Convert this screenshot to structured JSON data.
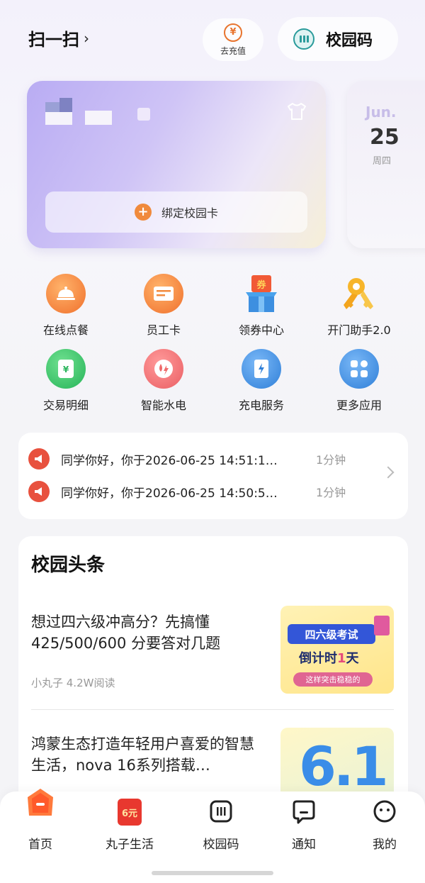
{
  "header": {
    "scan_label": "扫一扫",
    "scan_chevron": "›",
    "recharge_icon": "¥",
    "recharge_label": "去充值",
    "campus_code_label": "校园码"
  },
  "card": {
    "bind_label": "绑定校园卡"
  },
  "date_card": {
    "month": "Jun.",
    "day": "25",
    "weekday": "周四"
  },
  "apps": [
    {
      "label": "在线点餐",
      "icon": "food-cloche-icon",
      "color": "#f07a34"
    },
    {
      "label": "员工卡",
      "icon": "id-card-icon",
      "color": "#f07a34"
    },
    {
      "label": "领券中心",
      "icon": "coupon-box-icon",
      "color": "#f2893a"
    },
    {
      "label": "开门助手2.0",
      "icon": "key-icon",
      "color": "#f5b62c"
    },
    {
      "label": "交易明细",
      "icon": "transaction-icon",
      "color": "#38c36b"
    },
    {
      "label": "智能水电",
      "icon": "water-power-icon",
      "color": "#ef6a6a"
    },
    {
      "label": "充电服务",
      "icon": "charging-icon",
      "color": "#3a86e0"
    },
    {
      "label": "更多应用",
      "icon": "more-apps-icon",
      "color": "#3a86e0"
    }
  ],
  "notices": [
    {
      "text": "同学你好，你于2026-06-25 14:51:1…",
      "time": "1分钟"
    },
    {
      "text": "同学你好，你于2026-06-25 14:50:5…",
      "time": "1分钟"
    }
  ],
  "news": {
    "title": "校园头条",
    "articles": [
      {
        "headline": "想过四六级冲高分？先搞懂425/500/600 分要答对几题",
        "meta": "小丸子  4.2W阅读",
        "thumb": {
          "line1": "四六级考试",
          "line2a": "倒计时",
          "line2b": "1",
          "line2c": "天",
          "line3": "这样突击稳稳的"
        }
      },
      {
        "headline": "鸿蒙生态打造年轻用户喜爱的智慧生活，nova 16系列搭载…",
        "thumb": {
          "big": "6.1"
        }
      }
    ]
  },
  "tabs": [
    {
      "label": "首页",
      "icon": "home-icon",
      "active": true
    },
    {
      "label": "丸子生活",
      "icon": "life-red-envelope-icon",
      "badge": "6元"
    },
    {
      "label": "校园码",
      "icon": "qr-code-icon"
    },
    {
      "label": "通知",
      "icon": "message-icon"
    },
    {
      "label": "我的",
      "icon": "profile-face-icon"
    }
  ]
}
